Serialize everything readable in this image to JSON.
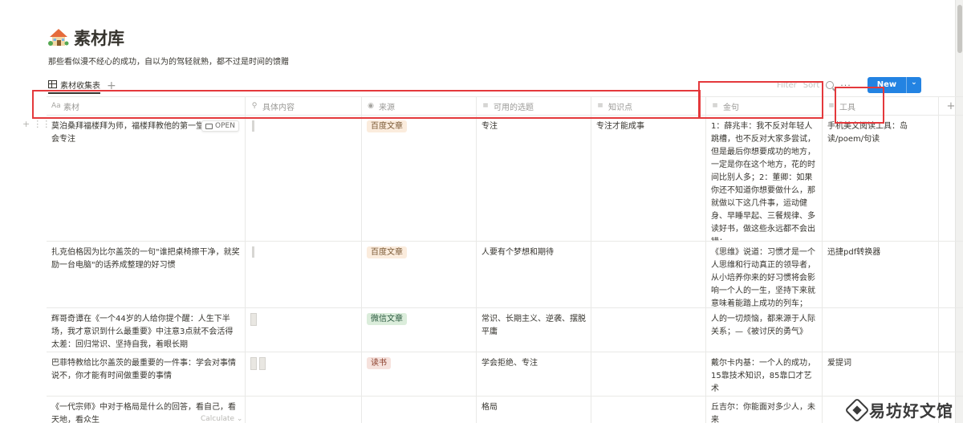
{
  "page": {
    "title": "素材库",
    "description": "那些看似漫不经心的成功，自以为的驾轻就熟，都不过是时间的馈赠",
    "icon": "house-icon"
  },
  "views": {
    "active": "素材收集表",
    "add_label": "+"
  },
  "toolbar": {
    "filter": "Filter",
    "sort": "Sort",
    "more": "···",
    "new_label": "New",
    "new_arrow": "⌄"
  },
  "columns": [
    {
      "label": "素材",
      "icon": "Aa"
    },
    {
      "label": "具体内容",
      "icon": "paperclip-icon"
    },
    {
      "label": "来源",
      "icon": "select-icon"
    },
    {
      "label": "可用的选题",
      "icon": "text-icon"
    },
    {
      "label": "知识点",
      "icon": "text-icon"
    },
    {
      "label": "金句",
      "icon": "text-icon"
    },
    {
      "label": "工具",
      "icon": "text-icon"
    },
    {
      "label": "+",
      "icon": ""
    }
  ],
  "rows": [
    {
      "material": "莫泊桑拜福楼拜为师，福楼拜教他的第一堂课——学会专注",
      "open_label": "OPEN",
      "source": "百度文章",
      "topics": "专注",
      "knowledge": "专注才能成事",
      "quote": "1：薛兆丰：我不反对年轻人跳槽，也不反对大家多尝试，但是最后你想要成功的地方，一定是你在这个地方，花的时间比别人多；2：董卿：如果你还不知道你想要做什么，那就做以下这几件事，运动健身、早睡早起、三餐规律、多读好书，做这些永远都不会出错；",
      "tool": "手机美文阅读工具：岛读/poem/句读"
    },
    {
      "material": "扎克伯格因为比尔盖茨的一句\"谁把桌椅擦干净，就奖励一台电脑\"的话养成整理的好习惯",
      "source": "百度文章",
      "topics": "人要有个梦想和期待",
      "knowledge": "",
      "quote": "《思维》说道：习惯才是一个人思维和行动真正的领导者，从小培养你来的好习惯将会影响一个人的一生，坚持下来就意味着能踏上成功的列车；",
      "tool": "迅捷pdf转换器"
    },
    {
      "material": "辉哥奇谭在《一个44岁的人给你提个醒：人生下半场，我才意识到什么最重要》中注意3点就不会活得太差：回归常识、坚持自我，着眼长期",
      "source": "微信文章",
      "topics": "常识、长期主义、逆袭、摆脱平庸",
      "knowledge": "",
      "quote": "人的一切烦恼，都来源于人际关系；—《被讨厌的勇气》",
      "tool": ""
    },
    {
      "material": "巴菲特教给比尔盖茨的最重要的一件事：学会对事情说不，你才能有时间做重要的事情",
      "source": "读书",
      "topics": "学会拒绝、专注",
      "knowledge": "",
      "quote": "戴尔卡内基：一个人的成功，15靠技术知识，85靠口才艺术",
      "tool": "爱提词"
    },
    {
      "material": "《一代宗师》中对于格局是什么的回答，看自己，看天地，看众生",
      "source": "",
      "topics": "格局",
      "knowledge": "",
      "quote": "丘吉尔：你能面对多少人，未来",
      "tool": ""
    }
  ],
  "footer": {
    "calculate": "Calculate ⌄"
  },
  "watermark": {
    "text": "易坊好文馆"
  },
  "colors": {
    "accent": "#2383e2",
    "annotation_red": "#e4393c",
    "tag_baidu_bg": "#fbecdd",
    "tag_weixin_bg": "#dbeddb",
    "tag_dushu_bg": "#f6e2dd"
  }
}
